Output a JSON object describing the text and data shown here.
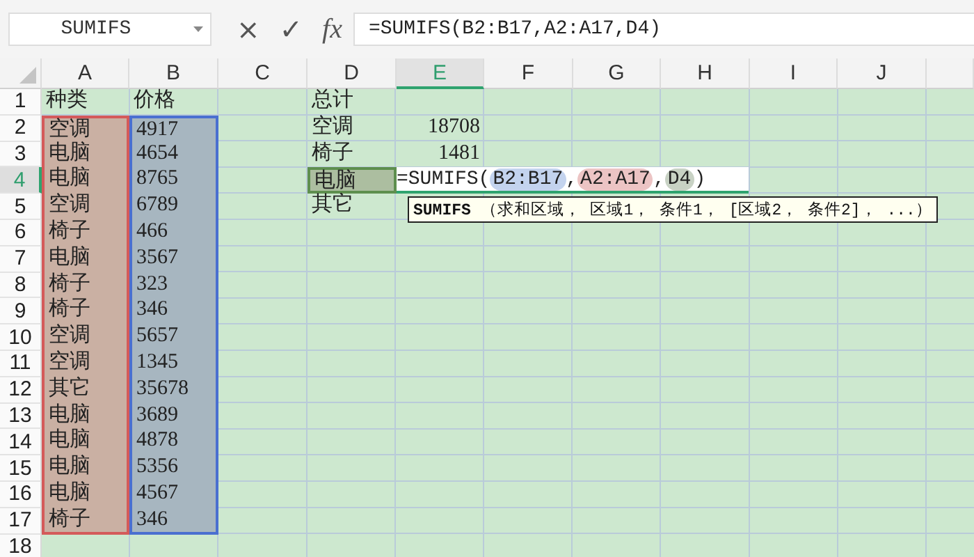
{
  "name_box": {
    "value": "SUMIFS"
  },
  "formula_bar": {
    "cancel": "×",
    "confirm": "✓",
    "fx": "fx",
    "value": "=SUMIFS(B2:B17,A2:A17,D4)"
  },
  "columns": [
    {
      "label": "A",
      "selected": false
    },
    {
      "label": "B",
      "selected": false
    },
    {
      "label": "C",
      "selected": false
    },
    {
      "label": "D",
      "selected": false
    },
    {
      "label": "E",
      "selected": true
    },
    {
      "label": "F",
      "selected": false
    },
    {
      "label": "G",
      "selected": false
    },
    {
      "label": "H",
      "selected": false
    },
    {
      "label": "I",
      "selected": false
    },
    {
      "label": "J",
      "selected": false
    }
  ],
  "rows": [
    {
      "number": "1",
      "selected": false,
      "cells": [
        {
          "text": "种类"
        },
        {
          "text": "价格"
        },
        null,
        {
          "text": "总计"
        }
      ]
    },
    {
      "number": "2",
      "selected": false,
      "cells": [
        {
          "text": "空调",
          "color": "#d45a5a"
        },
        {
          "text": "4917",
          "color": "#4a6fd0"
        },
        null,
        {
          "text": "空调"
        },
        {
          "text": "18708",
          "kind": "number"
        }
      ]
    },
    {
      "number": "3",
      "selected": false,
      "cells": [
        {
          "text": "电脑",
          "color": "#d45a5a"
        },
        {
          "text": "4654",
          "color": "#4a6fd0"
        },
        null,
        {
          "text": "椅子"
        },
        {
          "text": "1481",
          "kind": "number"
        }
      ]
    },
    {
      "number": "4",
      "selected": true,
      "cells": [
        {
          "text": "电脑",
          "color": "#d45a5a"
        },
        {
          "text": "8765",
          "color": "#4a6fd0"
        },
        null,
        {
          "text": "电脑",
          "color": "#5e8f4e"
        }
      ]
    },
    {
      "number": "5",
      "selected": false,
      "cells": [
        {
          "text": "空调",
          "color": "#d45a5a"
        },
        {
          "text": "6789",
          "color": "#4a6fd0"
        },
        null,
        {
          "text": "其它"
        }
      ]
    },
    {
      "number": "6",
      "selected": false,
      "cells": [
        {
          "text": "椅子",
          "color": "#d45a5a"
        },
        {
          "text": "466",
          "color": "#4a6fd0"
        }
      ]
    },
    {
      "number": "7",
      "selected": false,
      "cells": [
        {
          "text": "电脑",
          "color": "#d45a5a"
        },
        {
          "text": "3567",
          "color": "#4a6fd0"
        }
      ]
    },
    {
      "number": "8",
      "selected": false,
      "cells": [
        {
          "text": "椅子",
          "color": "#d45a5a"
        },
        {
          "text": "323",
          "color": "#4a6fd0"
        }
      ]
    },
    {
      "number": "9",
      "selected": false,
      "cells": [
        {
          "text": "椅子",
          "color": "#d45a5a"
        },
        {
          "text": "346",
          "color": "#4a6fd0"
        }
      ]
    },
    {
      "number": "10",
      "selected": false,
      "cells": [
        {
          "text": "空调",
          "color": "#d45a5a"
        },
        {
          "text": "5657",
          "color": "#4a6fd0"
        }
      ]
    },
    {
      "number": "11",
      "selected": false,
      "cells": [
        {
          "text": "空调",
          "color": "#d45a5a"
        },
        {
          "text": "1345",
          "color": "#4a6fd0"
        }
      ]
    },
    {
      "number": "12",
      "selected": false,
      "cells": [
        {
          "text": "其它",
          "color": "#d45a5a"
        },
        {
          "text": "35678",
          "color": "#4a6fd0"
        }
      ]
    },
    {
      "number": "13",
      "selected": false,
      "cells": [
        {
          "text": "电脑",
          "color": "#d45a5a"
        },
        {
          "text": "3689",
          "color": "#4a6fd0"
        }
      ]
    },
    {
      "number": "14",
      "selected": false,
      "cells": [
        {
          "text": "电脑",
          "color": "#d45a5a"
        },
        {
          "text": "4878",
          "color": "#4a6fd0"
        }
      ]
    },
    {
      "number": "15",
      "selected": false,
      "cells": [
        {
          "text": "电脑",
          "color": "#d45a5a"
        },
        {
          "text": "5356",
          "color": "#4a6fd0"
        }
      ]
    },
    {
      "number": "16",
      "selected": false,
      "cells": [
        {
          "text": "电脑",
          "color": "#d45a5a"
        },
        {
          "text": "4567",
          "color": "#4a6fd0"
        }
      ]
    },
    {
      "number": "17",
      "selected": false,
      "cells": [
        {
          "text": "椅子",
          "color": "#d45a5a"
        },
        {
          "text": "346",
          "color": "#4a6fd0"
        }
      ]
    },
    {
      "number": "18",
      "selected": false,
      "cells": []
    }
  ],
  "editor": {
    "tokens": [
      {
        "kind": "text",
        "text": "=SUMIFS("
      },
      {
        "kind": "ref",
        "text": "B2:B17",
        "color": "#c3d3ee"
      },
      {
        "kind": "text",
        "text": ","
      },
      {
        "kind": "ref",
        "text": "A2:A17",
        "color": "#ecc4c4"
      },
      {
        "kind": "text",
        "text": ","
      },
      {
        "kind": "ref",
        "text": "D4",
        "color": "#c8d2c4"
      },
      {
        "kind": "text",
        "text": ")"
      }
    ]
  },
  "tooltip": {
    "text": "**SUMIFS** （求和区域， 区域1， 条件1， [区域2， 条件2]， ...）"
  }
}
